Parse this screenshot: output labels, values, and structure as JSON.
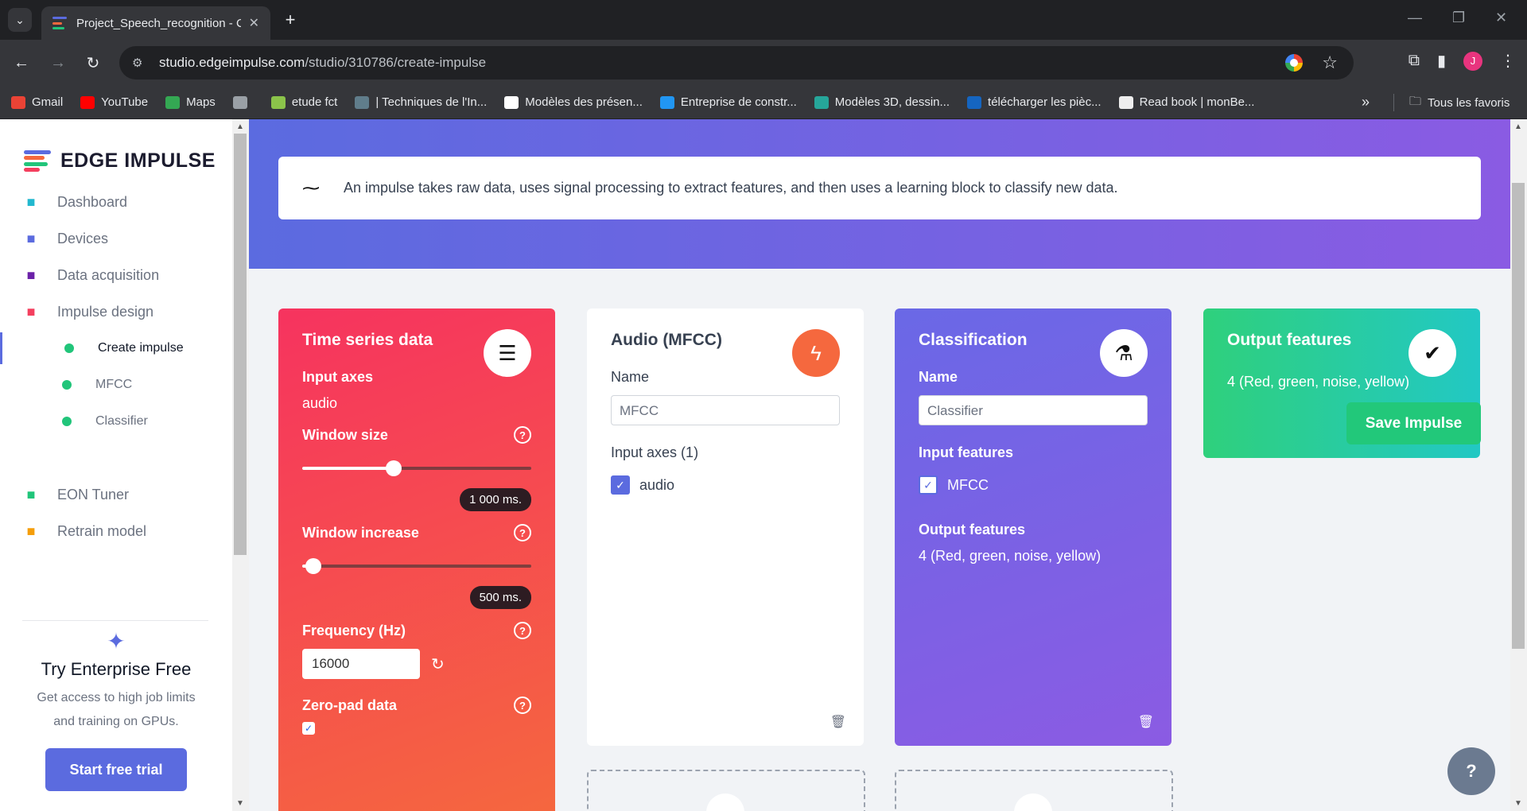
{
  "browser": {
    "tab_title": "Project_Speech_recognition - C",
    "url_host": "studio.edgeimpulse.com",
    "url_path": "/studio/310786/create-impulse",
    "avatar_letter": "J",
    "bookmarks": [
      {
        "label": "Gmail",
        "icon": "gmail-icon",
        "color": "#ea4335"
      },
      {
        "label": "YouTube",
        "icon": "youtube-icon",
        "color": "#ff0000"
      },
      {
        "label": "Maps",
        "icon": "maps-icon",
        "color": "#34a853"
      },
      {
        "label": "",
        "icon": "globe-icon",
        "color": "#9aa0a6"
      },
      {
        "label": "etude fct",
        "icon": "bookmark-icon",
        "color": "#8bc34a"
      },
      {
        "label": "| Techniques de l'In...",
        "icon": "bookmark-icon",
        "color": "#607d8b"
      },
      {
        "label": "Modèles des présen...",
        "icon": "bookmark-icon",
        "color": "#ffffff"
      },
      {
        "label": "Entreprise de constr...",
        "icon": "bookmark-icon",
        "color": "#2196f3"
      },
      {
        "label": "Modèles 3D, dessin...",
        "icon": "bookmark-icon",
        "color": "#26a69a"
      },
      {
        "label": "télécharger les pièc...",
        "icon": "skf-icon",
        "color": "#1565c0"
      },
      {
        "label": "Read book | monBe...",
        "icon": "bookmark-icon",
        "color": "#eeeeee"
      }
    ],
    "all_bookmarks": "Tous les favoris"
  },
  "sidebar": {
    "brand": "EDGE IMPULSE",
    "items": [
      {
        "label": "Dashboard",
        "icon": "monitor-icon",
        "color": "#22b8cf"
      },
      {
        "label": "Devices",
        "icon": "chip-icon",
        "color": "#5b6bdf"
      },
      {
        "label": "Data acquisition",
        "icon": "database-icon",
        "color": "#6b21a8"
      },
      {
        "label": "Impulse design",
        "icon": "pulse-icon",
        "color": "#f43f5e"
      }
    ],
    "subitems": [
      {
        "label": "Create impulse"
      },
      {
        "label": "MFCC"
      },
      {
        "label": "Classifier"
      }
    ],
    "items2": [
      {
        "label": "EON Tuner",
        "icon": "compass-icon",
        "color": "#21c57a"
      },
      {
        "label": "Retrain model",
        "icon": "shuffle-icon",
        "color": "#f59e0b"
      }
    ],
    "enterprise": {
      "title": "Try Enterprise Free",
      "desc1": "Get access to high job limits",
      "desc2": "and training on GPUs.",
      "button": "Start free trial"
    }
  },
  "main": {
    "info": "An impulse takes raw data, uses signal processing to extract features, and then uses a learning block to classify new data.",
    "time_series": {
      "title": "Time series data",
      "input_axes_label": "Input axes",
      "input_axes_value": "audio",
      "window_size_label": "Window size",
      "window_size_value": "1 000 ms.",
      "window_size_fraction": 0.4,
      "window_increase_label": "Window increase",
      "window_increase_value": "500 ms.",
      "window_increase_fraction": 0.05,
      "frequency_label": "Frequency (Hz)",
      "frequency_value": "16000",
      "zero_pad_label": "Zero-pad data"
    },
    "mfcc": {
      "title": "Audio (MFCC)",
      "name_label": "Name",
      "name_value": "MFCC",
      "input_axes_label": "Input axes (1)",
      "axis": "audio"
    },
    "classification": {
      "title": "Classification",
      "name_label": "Name",
      "name_value": "Classifier",
      "input_features_label": "Input features",
      "input_feature": "MFCC",
      "output_features_label": "Output features",
      "output_features_value": "4 (Red, green, noise, yellow)"
    },
    "output": {
      "title": "Output features",
      "value": "4 (Red, green, noise, yellow)"
    },
    "save_button": "Save Impulse"
  }
}
